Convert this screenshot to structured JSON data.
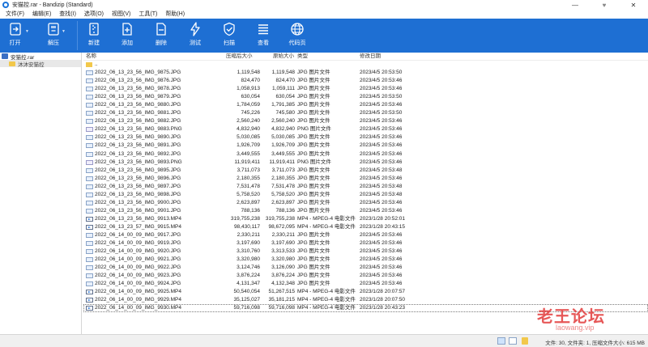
{
  "window": {
    "title": "安猫控.rar - Bandizip (Standard)"
  },
  "window_controls": {
    "minimize": "—",
    "restore": "♥",
    "close": "✕"
  },
  "menu": [
    "文件(F)",
    "编辑(E)",
    "查找(I)",
    "选项(O)",
    "视图(V)",
    "工具(T)",
    "帮助(H)"
  ],
  "toolbar": {
    "open": "打开",
    "extract": "解压",
    "new": "新建",
    "add": "添加",
    "delete": "删除",
    "test": "测试",
    "scan": "扫描",
    "view": "查看",
    "codepage": "代码页",
    "drop_arrow": "▼"
  },
  "tree": {
    "archive": "安猫控.rar",
    "folder": "沐沐安猫控"
  },
  "columns": {
    "name": "名称",
    "packed": "压缩后大小",
    "size": "原始大小",
    "type": "类型",
    "modified": "修改日期"
  },
  "parent_row": "..",
  "files": [
    {
      "icon": "jpg",
      "name": "2022_06_13_23_56_IMG_9875.JPG",
      "packed": "1,119,548",
      "size": "1,119,548",
      "type": "JPG 图片文件",
      "modified": "2023/4/5 20:53:50"
    },
    {
      "icon": "jpg",
      "name": "2022_06_13_23_56_IMG_9876.JPG",
      "packed": "824,470",
      "size": "824,470",
      "type": "JPG 图片文件",
      "modified": "2023/4/5 20:53:46"
    },
    {
      "icon": "jpg",
      "name": "2022_06_13_23_56_IMG_9878.JPG",
      "packed": "1,058,913",
      "size": "1,059,111",
      "type": "JPG 图片文件",
      "modified": "2023/4/5 20:53:46"
    },
    {
      "icon": "jpg",
      "name": "2022_06_13_23_56_IMG_9879.JPG",
      "packed": "630,054",
      "size": "630,054",
      "type": "JPG 图片文件",
      "modified": "2023/4/5 20:53:50"
    },
    {
      "icon": "jpg",
      "name": "2022_06_13_23_56_IMG_9880.JPG",
      "packed": "1,784,059",
      "size": "1,791,385",
      "type": "JPG 图片文件",
      "modified": "2023/4/5 20:53:46"
    },
    {
      "icon": "jpg",
      "name": "2022_06_13_23_56_IMG_9881.JPG",
      "packed": "745,226",
      "size": "745,580",
      "type": "JPG 图片文件",
      "modified": "2023/4/5 20:53:50"
    },
    {
      "icon": "jpg",
      "name": "2022_06_13_23_56_IMG_9882.JPG",
      "packed": "2,560,240",
      "size": "2,560,240",
      "type": "JPG 图片文件",
      "modified": "2023/4/5 20:53:46"
    },
    {
      "icon": "png",
      "name": "2022_06_13_23_56_IMG_9883.PNG",
      "packed": "4,832,940",
      "size": "4,832,940",
      "type": "PNG 图片文件",
      "modified": "2023/4/5 20:53:46"
    },
    {
      "icon": "jpg",
      "name": "2022_06_13_23_56_IMG_9890.JPG",
      "packed": "5,030,085",
      "size": "5,030,085",
      "type": "JPG 图片文件",
      "modified": "2023/4/5 20:53:46"
    },
    {
      "icon": "jpg",
      "name": "2022_06_13_23_56_IMG_9891.JPG",
      "packed": "1,926,709",
      "size": "1,926,709",
      "type": "JPG 图片文件",
      "modified": "2023/4/5 20:53:46"
    },
    {
      "icon": "jpg",
      "name": "2022_06_13_23_56_IMG_9892.JPG",
      "packed": "3,449,555",
      "size": "3,449,555",
      "type": "JPG 图片文件",
      "modified": "2023/4/5 20:53:46"
    },
    {
      "icon": "png",
      "name": "2022_06_13_23_56_IMG_9893.PNG",
      "packed": "11,919,411",
      "size": "11,919,411",
      "type": "PNG 图片文件",
      "modified": "2023/4/5 20:53:46"
    },
    {
      "icon": "jpg",
      "name": "2022_06_13_23_56_IMG_9895.JPG",
      "packed": "3,711,073",
      "size": "3,711,073",
      "type": "JPG 图片文件",
      "modified": "2023/4/5 20:53:48"
    },
    {
      "icon": "jpg",
      "name": "2022_06_13_23_56_IMG_9896.JPG",
      "packed": "2,180,355",
      "size": "2,180,355",
      "type": "JPG 图片文件",
      "modified": "2023/4/5 20:53:46"
    },
    {
      "icon": "jpg",
      "name": "2022_06_13_23_56_IMG_9897.JPG",
      "packed": "7,531,478",
      "size": "7,531,478",
      "type": "JPG 图片文件",
      "modified": "2023/4/5 20:53:48"
    },
    {
      "icon": "jpg",
      "name": "2022_06_13_23_56_IMG_9898.JPG",
      "packed": "5,758,520",
      "size": "5,758,520",
      "type": "JPG 图片文件",
      "modified": "2023/4/5 20:53:48"
    },
    {
      "icon": "jpg",
      "name": "2022_06_13_23_56_IMG_9900.JPG",
      "packed": "2,623,897",
      "size": "2,623,897",
      "type": "JPG 图片文件",
      "modified": "2023/4/5 20:53:46"
    },
    {
      "icon": "jpg",
      "name": "2022_06_13_23_56_IMG_9901.JPG",
      "packed": "788,136",
      "size": "788,136",
      "type": "JPG 图片文件",
      "modified": "2023/4/5 20:53:46"
    },
    {
      "icon": "mp4",
      "name": "2022_06_13_23_56_IMG_9913.MP4",
      "packed": "319,755,238",
      "size": "319,755,238",
      "type": "MP4 - MPEG-4 电影文件",
      "modified": "2023/1/28 20:52:01"
    },
    {
      "icon": "mp4",
      "name": "2022_06_13_23_57_IMG_9915.MP4",
      "packed": "98,430,117",
      "size": "98,672,095",
      "type": "MP4 - MPEG-4 电影文件",
      "modified": "2023/1/28 20:43:15"
    },
    {
      "icon": "jpg",
      "name": "2022_06_14_00_09_IMG_9917.JPG",
      "packed": "2,330,211",
      "size": "2,330,211",
      "type": "JPG 图片文件",
      "modified": "2023/4/5 20:53:46"
    },
    {
      "icon": "jpg",
      "name": "2022_06_14_00_09_IMG_9919.JPG",
      "packed": "3,197,690",
      "size": "3,197,690",
      "type": "JPG 图片文件",
      "modified": "2023/4/5 20:53:46"
    },
    {
      "icon": "jpg",
      "name": "2022_06_14_00_09_IMG_9920.JPG",
      "packed": "3,310,760",
      "size": "3,313,533",
      "type": "JPG 图片文件",
      "modified": "2023/4/5 20:53:46"
    },
    {
      "icon": "jpg",
      "name": "2022_06_14_00_09_IMG_9921.JPG",
      "packed": "3,320,980",
      "size": "3,320,980",
      "type": "JPG 图片文件",
      "modified": "2023/4/5 20:53:46"
    },
    {
      "icon": "jpg",
      "name": "2022_06_14_00_09_IMG_9922.JPG",
      "packed": "3,124,746",
      "size": "3,126,090",
      "type": "JPG 图片文件",
      "modified": "2023/4/5 20:53:46"
    },
    {
      "icon": "jpg",
      "name": "2022_06_14_00_09_IMG_9923.JPG",
      "packed": "3,876,224",
      "size": "3,876,224",
      "type": "JPG 图片文件",
      "modified": "2023/4/5 20:53:46"
    },
    {
      "icon": "jpg",
      "name": "2022_06_14_00_09_IMG_9924.JPG",
      "packed": "4,131,347",
      "size": "4,132,348",
      "type": "JPG 图片文件",
      "modified": "2023/4/5 20:53:46"
    },
    {
      "icon": "mp4",
      "name": "2022_06_14_00_09_IMG_9925.MP4",
      "packed": "50,540,054",
      "size": "51,267,515",
      "type": "MP4 - MPEG-4 电影文件",
      "modified": "2023/1/28 20:07:57"
    },
    {
      "icon": "mp4",
      "name": "2022_06_14_00_09_IMG_9929.MP4",
      "packed": "35,125,027",
      "size": "35,181,215",
      "type": "MP4 - MPEG-4 电影文件",
      "modified": "2023/1/28 20:07:50"
    },
    {
      "icon": "mp4",
      "name": "2022_06_14_00_09_IMG_9930.MP4",
      "packed": "59,716,098",
      "size": "59,716,098",
      "type": "MP4 - MPEG-4 电影文件",
      "modified": "2023/1/28 20:43:23"
    }
  ],
  "selected_index": 29,
  "status": "文件: 30, 文件夹: 1, 压缩文件大小: 615 MB",
  "watermark": {
    "logo": "老王论坛",
    "url": "laowang.vip"
  },
  "colors": {
    "toolbar": "#1e6fd3",
    "tree_selection": "#e8e8e8",
    "watermark": "#e23a3a"
  }
}
